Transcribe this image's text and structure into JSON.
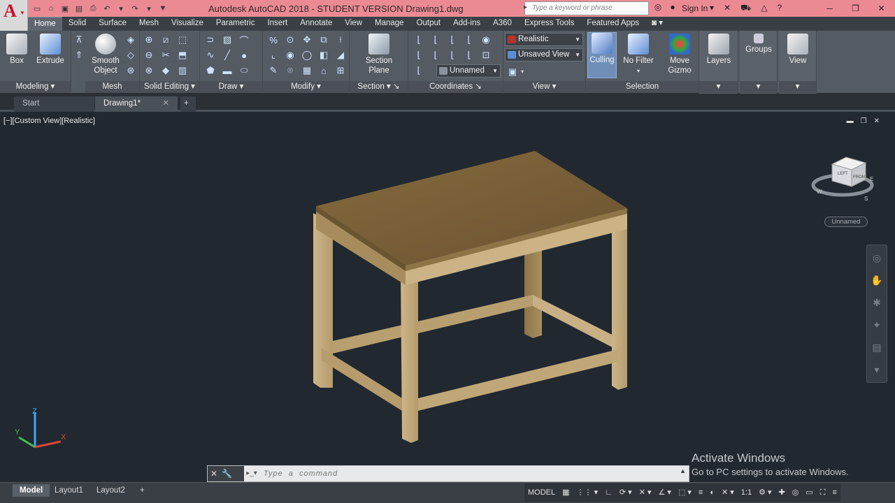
{
  "app": {
    "title": "Autodesk AutoCAD 2018 - STUDENT VERSION    Drawing1.dwg",
    "logo": "A"
  },
  "search": {
    "placeholder": "Type a keyword or phrase"
  },
  "account": {
    "signin": "Sign In"
  },
  "tabs": [
    "Home",
    "Solid",
    "Surface",
    "Mesh",
    "Visualize",
    "Parametric",
    "Insert",
    "Annotate",
    "View",
    "Manage",
    "Output",
    "Add-ins",
    "A360",
    "Express Tools",
    "Featured Apps"
  ],
  "ribbon": {
    "modeling": {
      "label": "Modeling",
      "box": "Box",
      "extrude": "Extrude"
    },
    "mesh": {
      "label": "Mesh",
      "smooth1": "Smooth",
      "smooth2": "Object"
    },
    "solid_editing": {
      "label": "Solid Editing"
    },
    "draw": {
      "label": "Draw"
    },
    "modify": {
      "label": "Modify"
    },
    "section": {
      "label": "Section",
      "btn1": "Section",
      "btn2": "Plane"
    },
    "coordinates": {
      "label": "Coordinates",
      "ucs": "Unnamed"
    },
    "view": {
      "label": "View",
      "visual_style": "Realistic",
      "saved_view": "Unsaved View"
    },
    "selection": {
      "label": "Selection",
      "culling": "Culling",
      "nofilter": "No Filter",
      "gizmo1": "Move",
      "gizmo2": "Gizmo"
    },
    "layers": "Layers",
    "groups": "Groups",
    "viewpanel": "View"
  },
  "doctabs": {
    "start": "Start",
    "drawing": "Drawing1*"
  },
  "viewport": {
    "label": "[−][Custom View][Realistic]",
    "viewcube_badge": "Unnamed"
  },
  "watermark": {
    "line1": "Activate Windows",
    "line2": "Go to PC settings to activate Windows."
  },
  "command": {
    "placeholder": "Type  a  command"
  },
  "layout_tabs": [
    "Model",
    "Layout1",
    "Layout2"
  ],
  "status": {
    "model": "MODEL",
    "scale": "1:1"
  },
  "colors": {
    "titlebar": "#ec8a93",
    "ribbon": "#555b63",
    "viewport": "#212830",
    "accent": "#5d8dd6"
  }
}
